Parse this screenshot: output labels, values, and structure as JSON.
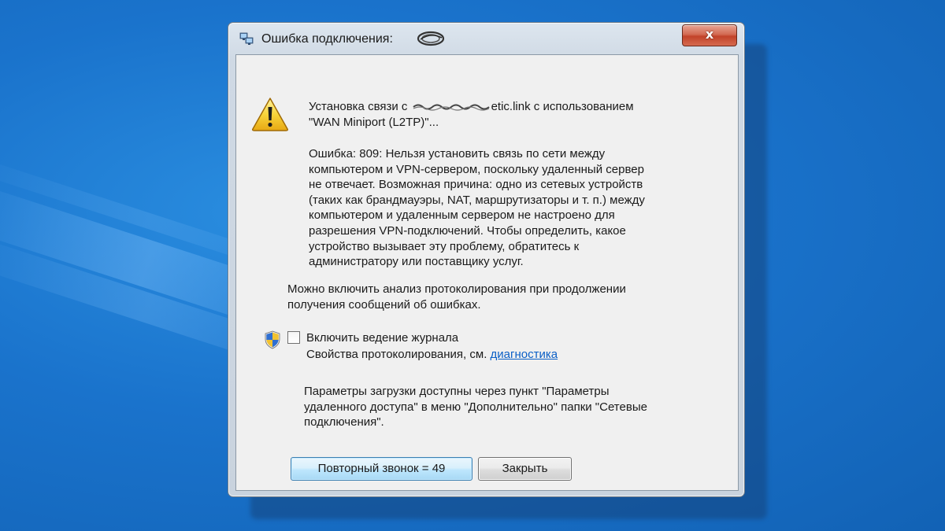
{
  "window": {
    "title": "Ошибка подключения:",
    "close_glyph": "x"
  },
  "message": {
    "connecting_line1_prefix": "Установка связи с",
    "connecting_line1_host_tail": "etic.link",
    "connecting_line1_suffix": "с использованием",
    "connecting_line2": "\"WAN Miniport (L2TP)\"...",
    "error_lines": [
      "Ошибка: 809: Нельзя установить связь по сети между",
      "компьютером и VPN-сервером, поскольку удаленный сервер",
      "не отвечает. Возможная причина: одно из сетевых устройств",
      "(таких как брандмауэры, NAT, маршрутизаторы и т. п.) между",
      "компьютером и удаленным сервером не настроено для",
      "разрешения VPN-подключений. Чтобы определить, какое",
      "устройство вызывает эту проблему, обратитесь к",
      "администратору или поставщику услуг."
    ],
    "logging_info_lines": [
      "Можно включить анализ протоколирования при продолжении",
      "получения сообщений об ошибках."
    ]
  },
  "logging": {
    "checkbox_label": "Включить ведение журнала",
    "checked": false,
    "props_prefix": "Свойства протоколирования, см.",
    "diagnostics_link": "диагностика"
  },
  "redial_info_lines": [
    "Параметры загрузки доступны через пункт \"Параметры",
    "удаленного доступа\" в меню \"Дополнительно\" папки \"Сетевые",
    "подключения\"."
  ],
  "buttons": {
    "redial": "Повторный звонок = 49",
    "close": "Закрыть"
  },
  "colors": {
    "desktop": "#1a73cc",
    "link": "#0b5fc6",
    "close_button": "#c2432a",
    "default_button_border": "#3c7fb1"
  },
  "icons": {
    "title": "network-computers-icon",
    "warning": "warning-triangle-icon",
    "uac": "uac-shield-icon"
  }
}
